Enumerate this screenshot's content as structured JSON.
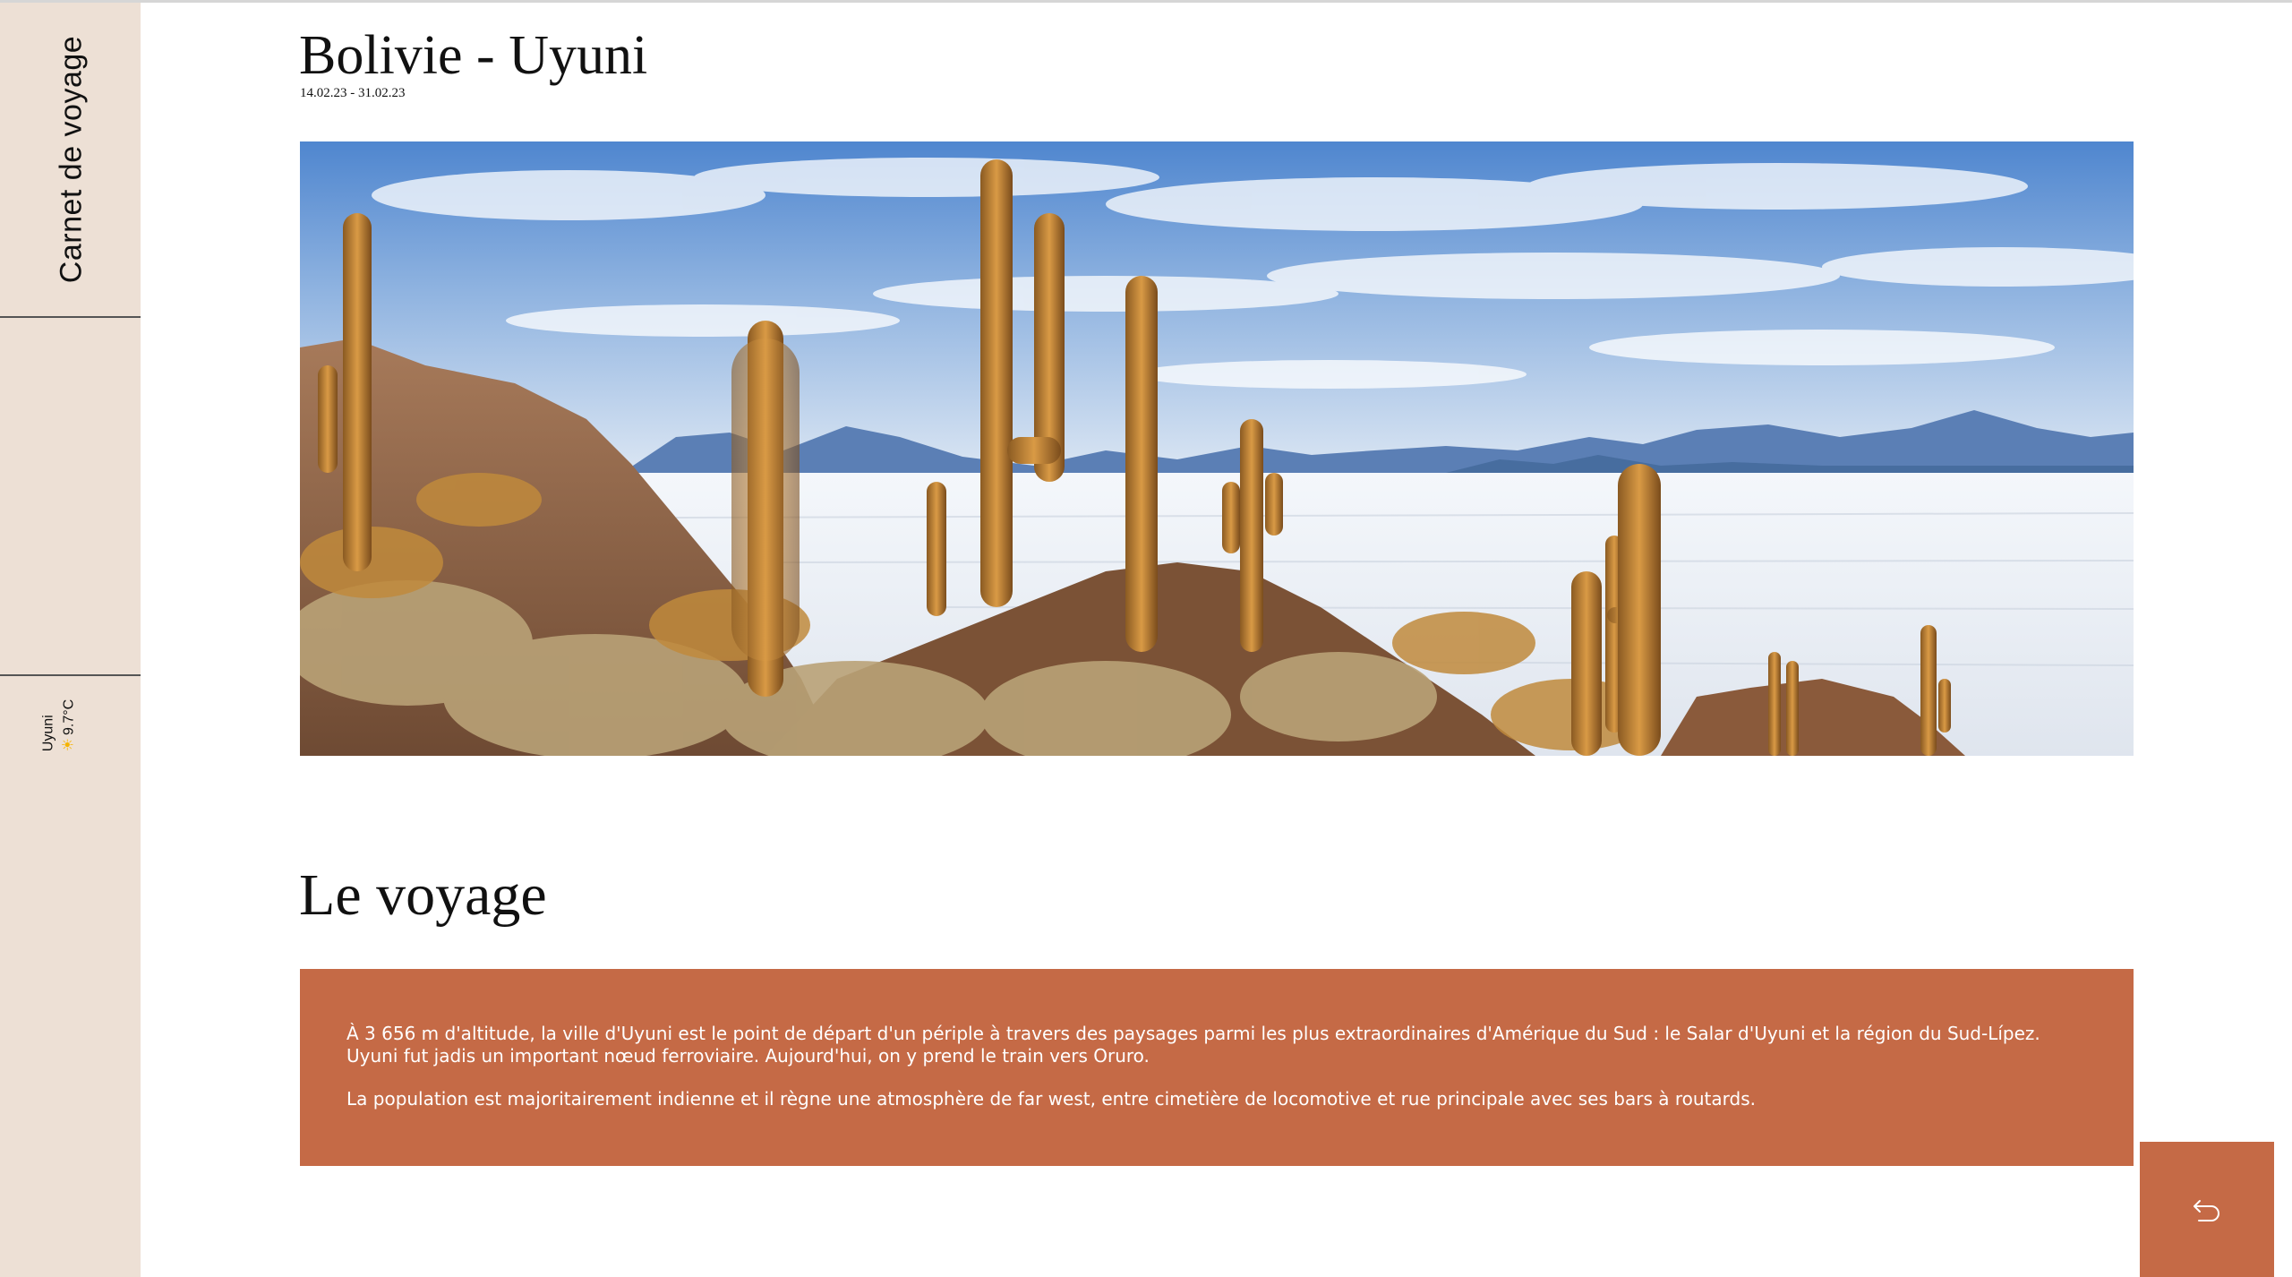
{
  "sidebar": {
    "title": "Carnet de voyage",
    "weather": {
      "city": "Uyuni",
      "icon": "sun-icon",
      "temperature": "9.7°C"
    }
  },
  "header": {
    "title": "Bolivie - Uyuni",
    "dates": "14.02.23 - 31.02.23"
  },
  "hero": {
    "image": "salar-uyuni-cactus-landscape"
  },
  "section": {
    "title": "Le voyage",
    "paragraphs": [
      "À 3 656 m d'altitude, la ville d'Uyuni est le point de départ d'un périple à travers des paysages parmi les plus extraordinaires d'Amérique du Sud : le Salar d'Uyuni et la région du Sud-Lípez.",
      "Uyuni fut jadis un important nœud ferroviaire. Aujourd'hui, on y prend le train vers Oruro.",
      "La population est majoritairement indienne et il règne une atmosphère de far west, entre cimetière de locomotive et rue principale avec ses bars à routards."
    ]
  },
  "back_button": {
    "icon": "return-arrow-icon"
  },
  "colors": {
    "sidebar_bg": "#ede0d5",
    "accent": "#c56a46",
    "text": "#111111"
  }
}
